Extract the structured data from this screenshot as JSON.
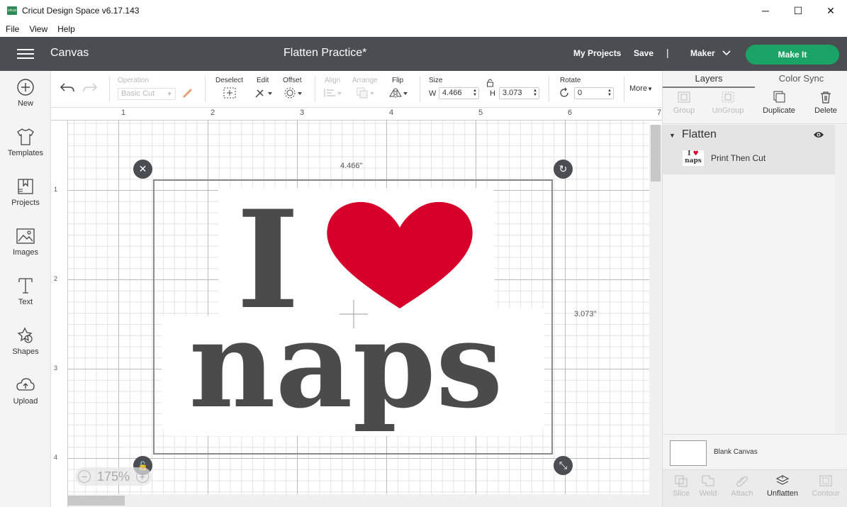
{
  "window": {
    "title": "Cricut Design Space  v6.17.143",
    "logo_text": "cricut",
    "minimize": "─",
    "maximize": "☐",
    "close": "✕"
  },
  "menu": [
    "File",
    "View",
    "Help"
  ],
  "header": {
    "section": "Canvas",
    "project_name": "Flatten Practice*",
    "my_projects": "My Projects",
    "save": "Save",
    "separator": "|",
    "machine": "Maker",
    "make_it": "Make It",
    "accent_color": "#1aa365",
    "bar_color": "#4a4d51"
  },
  "left_nav": [
    {
      "label": "New",
      "icon": "plus-circle-icon"
    },
    {
      "label": "Templates",
      "icon": "tshirt-icon"
    },
    {
      "label": "Projects",
      "icon": "bookmark-grid-icon"
    },
    {
      "label": "Images",
      "icon": "image-icon"
    },
    {
      "label": "Text",
      "icon": "text-icon"
    },
    {
      "label": "Shapes",
      "icon": "shapes-icon"
    },
    {
      "label": "Upload",
      "icon": "cloud-upload-icon"
    }
  ],
  "toolbar": {
    "operation_label": "Operation",
    "operation_value": "Basic Cut",
    "deselect": "Deselect",
    "edit": "Edit",
    "offset": "Offset",
    "align": "Align",
    "arrange": "Arrange",
    "flip": "Flip",
    "size_label": "Size",
    "w_label": "W",
    "w_value": "4.466",
    "h_label": "H",
    "h_value": "3.073",
    "rotate_label": "Rotate",
    "rotate_value": "0",
    "more": "More"
  },
  "canvas": {
    "ruler_top": [
      "1",
      "2",
      "3",
      "4",
      "5",
      "6",
      "7"
    ],
    "ruler_left": [
      "1",
      "2",
      "3",
      "4"
    ],
    "width_readout": "4.466\"",
    "height_readout": "3.073\"",
    "zoom": "175%",
    "design_line1_letter": "I",
    "design_line2": "naps",
    "heart_color": "#d6002a",
    "text_color": "#4b4b4b"
  },
  "right_panel": {
    "tabs": [
      "Layers",
      "Color Sync"
    ],
    "actions": [
      {
        "label": "Group",
        "enabled": false
      },
      {
        "label": "UnGroup",
        "enabled": false
      },
      {
        "label": "Duplicate",
        "enabled": true
      },
      {
        "label": "Delete",
        "enabled": true
      }
    ],
    "group_name": "Flatten",
    "layer_name": "Print Then Cut",
    "thumb_text_top": "I",
    "thumb_text_bottom": "naps",
    "blank_canvas": "Blank Canvas",
    "bottom_tools": [
      {
        "label": "Slice",
        "enabled": false
      },
      {
        "label": "Weld",
        "enabled": false
      },
      {
        "label": "Attach",
        "enabled": false
      },
      {
        "label": "Unflatten",
        "enabled": true
      },
      {
        "label": "Contour",
        "enabled": false
      }
    ]
  }
}
